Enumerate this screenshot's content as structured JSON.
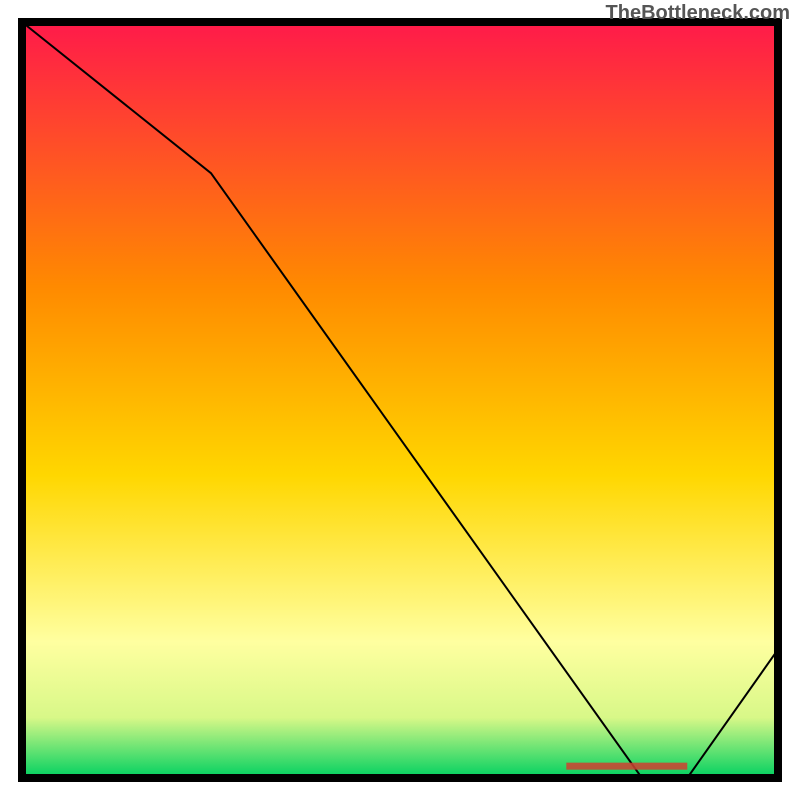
{
  "watermark": "TheBottleneck.com",
  "chart_data": {
    "type": "line",
    "title": "",
    "xlabel": "",
    "ylabel": "",
    "x": [
      0,
      25,
      82,
      88,
      100
    ],
    "y": [
      100,
      80,
      0,
      0,
      17
    ],
    "xlim": [
      0,
      100
    ],
    "ylim": [
      0,
      100
    ],
    "background_gradient": {
      "top": "#ff1a4a",
      "mid_upper": "#ff8a00",
      "mid": "#ffd700",
      "mid_lower": "#ffffa0",
      "bottom": "#00d060"
    },
    "border_color": "#000000",
    "line_color": "#000000",
    "annotation": {
      "text": "",
      "color": "#d04030",
      "x_start": 72,
      "x_end": 88,
      "y": 1.5
    }
  }
}
